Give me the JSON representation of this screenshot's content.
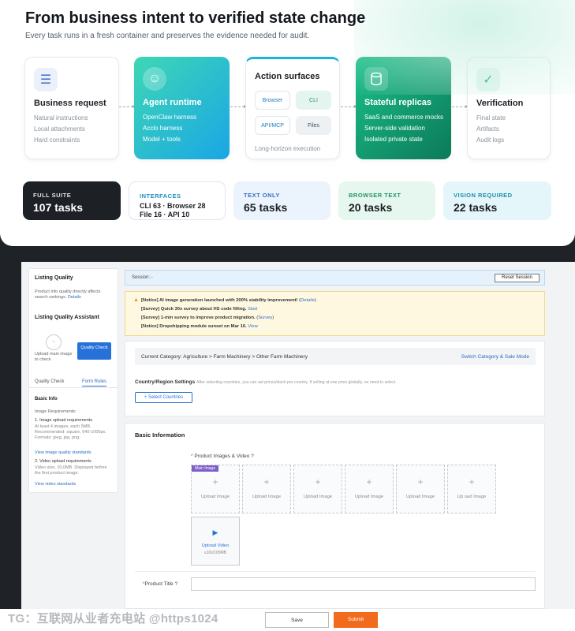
{
  "hero": {
    "title": "From business intent to verified state change",
    "subtitle": "Every task runs in a fresh container and preserves the evidence needed for audit."
  },
  "pipeline": {
    "business": {
      "title": "Business request",
      "lines": [
        "Natural instructions",
        "Local attachments",
        "Hard constraints"
      ]
    },
    "agent": {
      "title": "Agent runtime",
      "lines": [
        "OpenClaw harness",
        "Acclo harness",
        "Model + tools"
      ]
    },
    "surfaces": {
      "title": "Action surfaces",
      "pills": [
        "Browser",
        "CLI",
        "API/MCP",
        "Files"
      ],
      "footer": "Long-horizon execution"
    },
    "replicas": {
      "title": "Stateful replicas",
      "lines": [
        "SaaS and commerce mocks",
        "Server-side validation",
        "Isolated private state"
      ]
    },
    "verification": {
      "title": "Verification",
      "lines": [
        "Final state",
        "Artifacts",
        "Audit logs"
      ]
    }
  },
  "stats": [
    {
      "label": "FULL SUITE",
      "value": "107 tasks"
    },
    {
      "label": "INTERFACES",
      "line1": "CLI 63 · Browser 28",
      "line2": "File 16 · API 10"
    },
    {
      "label": "TEXT ONLY",
      "value": "65 tasks"
    },
    {
      "label": "BROWSER TEXT",
      "value": "20 tasks"
    },
    {
      "label": "VISION REQUIRED",
      "value": "22 tasks"
    }
  ],
  "listing": {
    "quality_title": "Listing Quality",
    "quality_desc": "Product info quality directly affects search rankings.",
    "quality_link": "Details",
    "assistant_title": "Listing Quality Assistant",
    "upload_hint": "Upload main image to check",
    "check_button": "Quality Check",
    "tabs": [
      "Quality Check",
      "Form Rules"
    ],
    "basic_info": "Basic Info",
    "img_req": "Image Requirements:",
    "req1_title": "1. Image upload requirements",
    "req1_text": "At least 4 images, each 5MB. Recommended: square, 640-1000px. Formats: jpeg, jpg, png.",
    "req1_link": "View image quality standards",
    "req2_title": "2. Video upload requirements",
    "req2_text": "Video size, 10,0MB. Displayed before the first product image.",
    "req2_link": "View video standards"
  },
  "session": {
    "label": "Session: -",
    "reset": "Reset Session"
  },
  "notices": [
    {
      "text": "[Notice] AI image generation launched with 200% stability improvement!",
      "link": "Details"
    },
    {
      "text": "[Survey] Quick 30s survey about HS code filling.",
      "link": "Start"
    },
    {
      "text": "[Survey] 1-min survey to improve product migration.",
      "link": "Survey"
    },
    {
      "text": "[Notice] Dropshipping module sunset on Mar 16.",
      "link": "View"
    }
  ],
  "category": {
    "current": "Current Category: Agriculture > Farm Machinery > Other Farm Machinery",
    "switch": "Switch Category & Sale Mode",
    "region_title": "Country/Region Settings",
    "region_desc": "After selecting countries, you can set prices/stock per country. If selling at one price globally, no need to select.",
    "select_btn": "+ Select Countries"
  },
  "basic": {
    "title": "Basic Information",
    "images_label": "Product Images & Video",
    "main_badge": "Main Image",
    "upload_image": "Upload Image",
    "upload_image_alt": "Up oad Image",
    "upload_video": "Upload Video",
    "video_size": "≤10s/100MB",
    "product_title_label": "Product Title"
  },
  "footer": {
    "watermark": "TG：互联网从业者充电站 @https1024",
    "save": "Save",
    "submit": "Submit"
  }
}
